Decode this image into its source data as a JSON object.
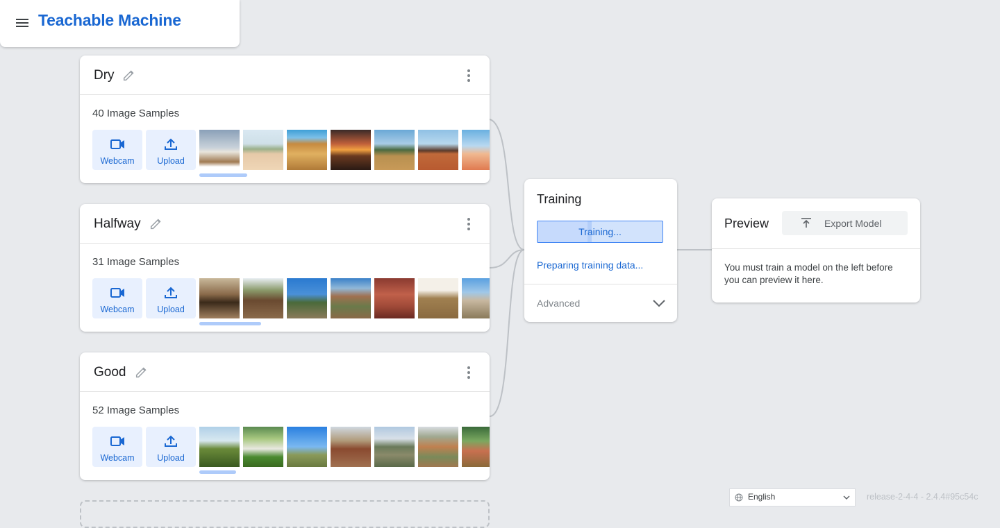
{
  "header": {
    "title": "Teachable Machine",
    "menu_icon": "hamburger-menu-icon"
  },
  "classes": [
    {
      "name": "Dry",
      "sample_count": "40 Image Samples",
      "webcam_label": "Webcam",
      "upload_label": "Upload"
    },
    {
      "name": "Halfway",
      "sample_count": "31 Image Samples",
      "webcam_label": "Webcam",
      "upload_label": "Upload"
    },
    {
      "name": "Good",
      "sample_count": "52 Image Samples",
      "webcam_label": "Webcam",
      "upload_label": "Upload"
    }
  ],
  "training": {
    "title": "Training",
    "button_label": "Training...",
    "progress": 0.4,
    "status": "Preparing training data...",
    "advanced_label": "Advanced"
  },
  "preview": {
    "title": "Preview",
    "export_label": "Export Model",
    "message": "You must train a model on the left before you can preview it here."
  },
  "footer": {
    "language": "English",
    "release": "release-2-4-4 - 2.4.4#95c54c"
  },
  "colors": {
    "brand": "#1967d2",
    "button_bg": "#e8f0fe",
    "background": "#e8eaed",
    "wire": "#bdc1c6"
  }
}
